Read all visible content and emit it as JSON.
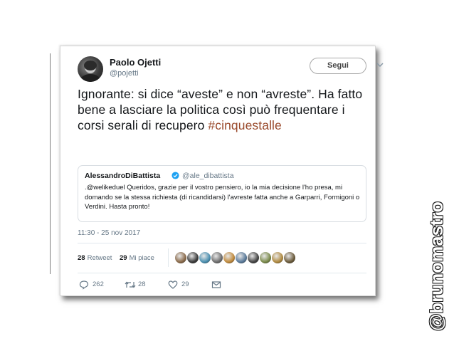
{
  "tweet": {
    "author_name": "Paolo Ojetti",
    "author_handle": "@pojetti",
    "follow_label": "Segui",
    "text_main": "Ignorante: si dice “aveste” e non “avreste”. Ha fatto bene a lasciare la politica così può frequentare i corsi serali di recupero",
    "hashtag": "#cinquestalle",
    "hashtag_color": "#9a4a2c",
    "timestamp": "11:30 - 25 nov 2017"
  },
  "quote": {
    "author_name": "AlessandroDiBattista",
    "author_handle": "@ale_dibattista",
    "text": ".@welikeduel Queridos, grazie per il vostro pensiero, io la mia decisione l'ho presa, mi domando se la stessa richiesta (di ricandidarsi) l'avreste fatta anche a Garparri, Formigoni o Verdini. Hasta pronto!",
    "verified_icon": "verified-badge-icon",
    "verified_color": "#1da1f2"
  },
  "stats": {
    "retweets_count": "28",
    "retweets_label": "Retweet",
    "likes_count": "29",
    "likes_label": "Mi piace",
    "liker_avatar_colors": [
      "#8a6a4a",
      "#3a3a3a",
      "#4a8fb0",
      "#6e6e6e",
      "#c08a3c",
      "#5a7a9a",
      "#444444",
      "#7a8a4a",
      "#b08a40",
      "#6a5a3a"
    ]
  },
  "actions": {
    "reply_count": "262",
    "retweet_count": "28",
    "like_count": "29",
    "icons": [
      "reply-icon",
      "retweet-icon",
      "heart-icon",
      "message-icon"
    ]
  },
  "watermark": "@brunomastro"
}
